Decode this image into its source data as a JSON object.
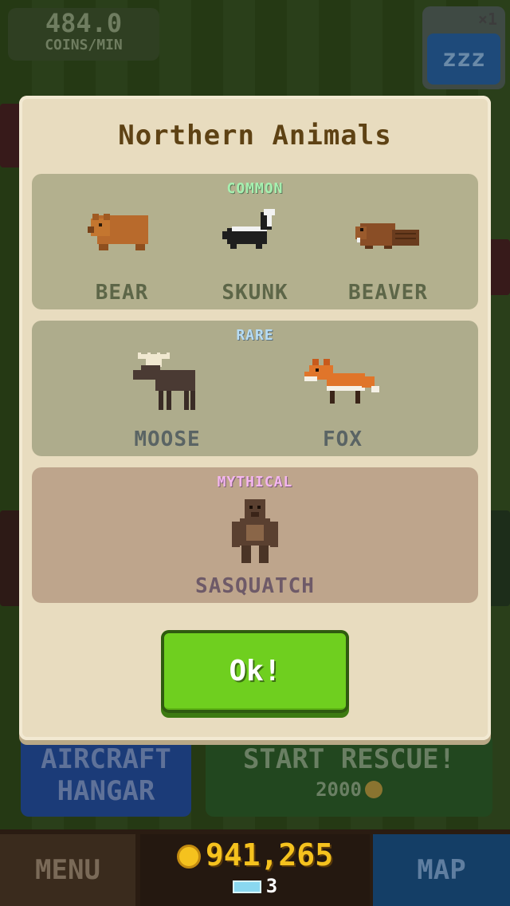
{
  "hud": {
    "coins_rate_value": "484.0",
    "coins_rate_unit": "COINS/MIN",
    "sleep_multiplier": "×1",
    "sleep_icon": "z-sleep-icon",
    "sleep_glyph": "zzz"
  },
  "modal": {
    "title": "Northern Animals",
    "sections": {
      "common": {
        "label": "COMMON",
        "animals": [
          "BEAR",
          "SKUNK",
          "BEAVER"
        ]
      },
      "rare": {
        "label": "RARE",
        "animals": [
          "MOOSE",
          "FOX"
        ]
      },
      "mythical": {
        "label": "MYTHICAL",
        "animals": [
          "SASQUATCH"
        ]
      }
    },
    "ok_label": "Ok!"
  },
  "actions": {
    "hangar_label": "AIRCRAFT HANGAR",
    "rescue_label": "START RESCUE!",
    "rescue_price": "2000"
  },
  "bottom_bar": {
    "menu_label": "MENU",
    "coins": "941,265",
    "gems": "3",
    "map_label": "MAP"
  },
  "colors": {
    "modal_bg": "#e8dcbf",
    "title": "#5e4214",
    "ok_button": "#6fcf1f",
    "coin": "#f5c21e"
  }
}
